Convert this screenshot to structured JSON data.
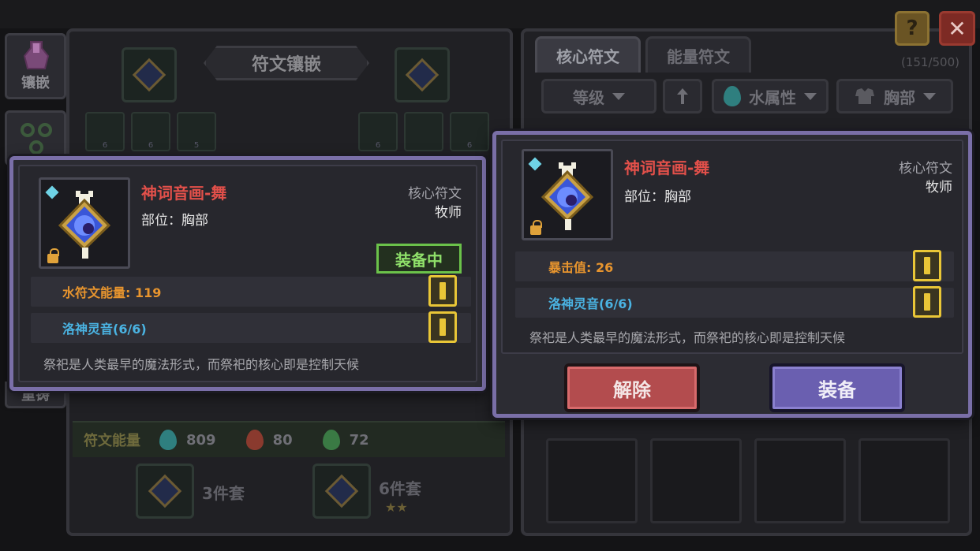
{
  "header": {
    "help_label": "?",
    "close_label": "✕"
  },
  "left_side": {
    "inlay_tab_label": "镶嵌",
    "recast_tab_label": "重铸"
  },
  "left_panel": {
    "title": "符文镶嵌",
    "mini_slot_levels": [
      "6",
      "6",
      "5",
      "6",
      "",
      "6"
    ],
    "energy": {
      "label": "符文能量",
      "items": [
        {
          "icon": "water-drop-icon",
          "value": "809",
          "color": "#3bb0b0"
        },
        {
          "icon": "fire-drop-icon",
          "value": "80",
          "color": "#c04a3a"
        },
        {
          "icon": "nature-drop-icon",
          "value": "72",
          "color": "#4aa05a"
        }
      ]
    },
    "sets": [
      {
        "label": "3件套",
        "stars": ""
      },
      {
        "label": "6件套",
        "stars": "★★"
      }
    ]
  },
  "right_panel": {
    "tabs": [
      "核心符文",
      "能量符文"
    ],
    "count": "(151/500)",
    "filters": {
      "level": "等级",
      "sort_icon": "arrow-up-icon",
      "element": "水属性",
      "slot": "胸部"
    }
  },
  "popup_left": {
    "name": "神词音画-舞",
    "type": "核心符文",
    "slot": "部位：胸部",
    "class": "牧师",
    "equipped_tag": "装备中",
    "stats": [
      {
        "text": "水符文能量: 119",
        "color": "orange"
      },
      {
        "text": "洛神灵音(6/6)",
        "color": "blue"
      }
    ],
    "description": "祭祀是人类最早的魔法形式，而祭祀的核心即是控制天候"
  },
  "popup_right": {
    "name": "神词音画-舞",
    "type": "核心符文",
    "slot": "部位：胸部",
    "class": "牧师",
    "stats": [
      {
        "text": "暴击值: 26",
        "color": "orange"
      },
      {
        "text": "洛神灵音(6/6)",
        "color": "blue"
      }
    ],
    "description": "祭祀是人类最早的魔法形式，而祭祀的核心即是控制天候",
    "remove_label": "解除",
    "equip_label": "装备"
  }
}
